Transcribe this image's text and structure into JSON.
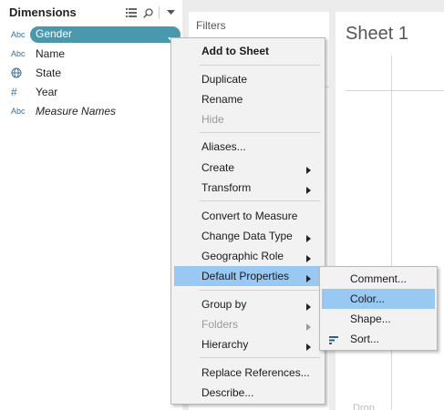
{
  "data_pane": {
    "title": "Dimensions",
    "tool_icons": [
      "grid-view-icon",
      "search-icon",
      "dropdown-icon"
    ],
    "selected_field": {
      "type": "Abc",
      "label": "Gender"
    },
    "fields": [
      {
        "type": "Abc",
        "icon": "string-type-icon",
        "label": "Name"
      },
      {
        "type": "globe",
        "icon": "globe-icon",
        "label": "State"
      },
      {
        "type": "#",
        "icon": "number-type-icon",
        "label": "Year"
      },
      {
        "type": "Abc",
        "icon": "string-type-icon",
        "label": "Measure Names"
      }
    ]
  },
  "filters": {
    "label": "Filters"
  },
  "sheet": {
    "title": "Sheet 1",
    "drop_hint": "Drop"
  },
  "context_menu": {
    "items": [
      {
        "label": "Add to Sheet",
        "bold": true
      },
      {
        "label": "Duplicate"
      },
      {
        "label": "Rename"
      },
      {
        "label": "Hide",
        "disabled": true
      },
      {
        "label": "Aliases..."
      },
      {
        "label": "Create",
        "submenu": true
      },
      {
        "label": "Transform",
        "submenu": true
      },
      {
        "label": "Convert to Measure"
      },
      {
        "label": "Change Data Type",
        "submenu": true
      },
      {
        "label": "Geographic Role",
        "submenu": true
      },
      {
        "label": "Default Properties",
        "submenu": true,
        "highlighted": true
      },
      {
        "label": "Group by",
        "submenu": true
      },
      {
        "label": "Folders",
        "submenu": true,
        "disabled": true
      },
      {
        "label": "Hierarchy",
        "submenu": true
      },
      {
        "label": "Replace References..."
      },
      {
        "label": "Describe..."
      }
    ]
  },
  "submenu": {
    "items": [
      {
        "label": "Comment..."
      },
      {
        "label": "Color...",
        "highlighted": true
      },
      {
        "label": "Shape..."
      },
      {
        "label": "Sort...",
        "icon": "sort-icon"
      }
    ]
  },
  "colors": {
    "pill": "#4a98ad",
    "highlight": "#99c9f2",
    "type_icon": "#3b6f9a"
  }
}
